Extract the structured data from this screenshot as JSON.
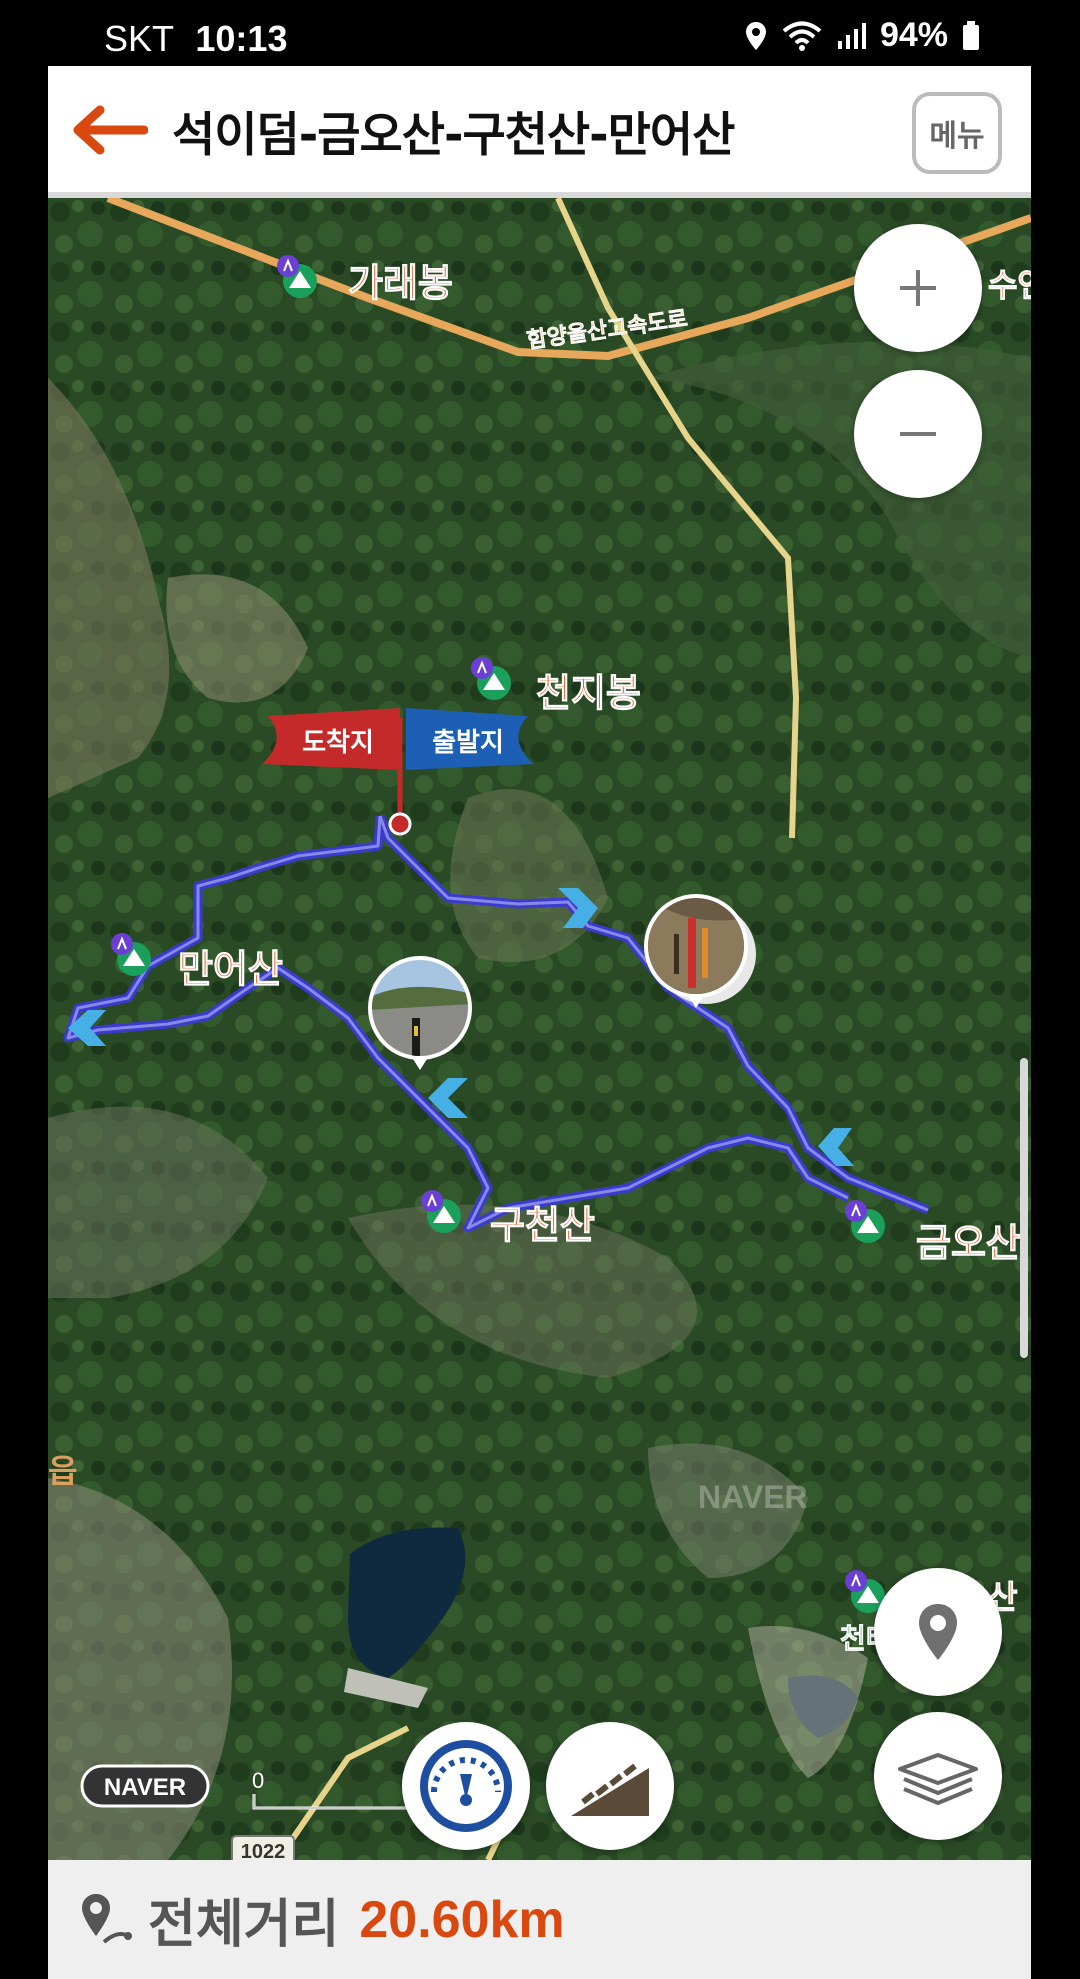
{
  "status_bar": {
    "carrier": "SKT",
    "time": "10:13",
    "battery": "94%"
  },
  "header": {
    "title": "석이덤-금오산-구천산-만어산",
    "menu_label": "메뉴",
    "back_icon": "arrow-left-icon"
  },
  "map": {
    "road_label": "함양울산고속도로",
    "peaks": [
      "가래봉",
      "천지봉",
      "만어산",
      "구천산",
      "금오산"
    ],
    "partial_labels": [
      "수연",
      "읍",
      "천태",
      "산"
    ],
    "flags": {
      "end": "도착지",
      "start": "출발지"
    },
    "route_number": "1022",
    "logo": "NAVER",
    "watermark": "NAVER",
    "scale_zero": "0",
    "colors": {
      "route": "#3a3ad6",
      "end_flag": "#c42a2a",
      "start_flag": "#1c5fb5",
      "accent": "#d9480f"
    }
  },
  "summary": {
    "distance_label": "전체거리",
    "distance_value": "20.60km"
  }
}
